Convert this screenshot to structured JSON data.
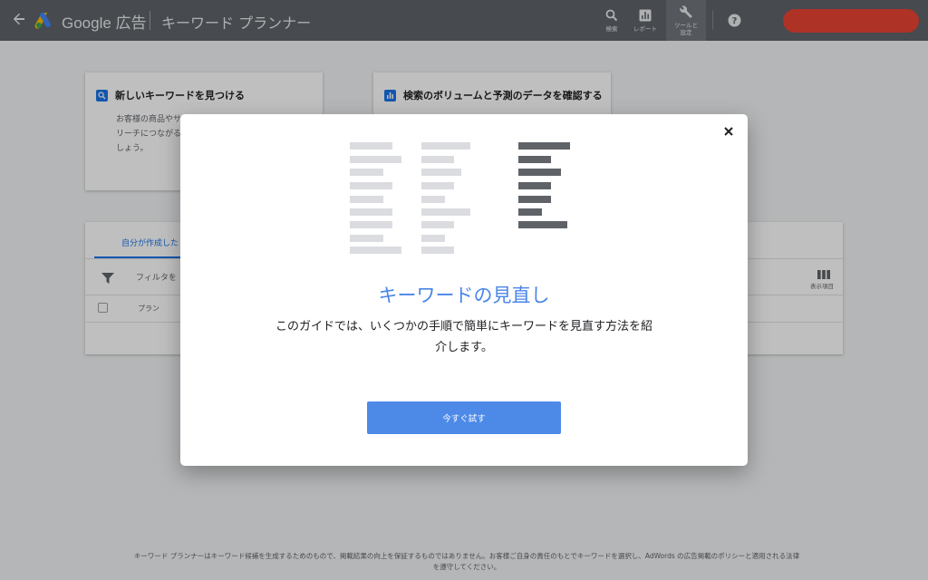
{
  "header": {
    "back_icon": "arrow-left-icon",
    "brand": "Google 広告",
    "product": "キーワード プランナー",
    "search_label": "検索",
    "report_label": "レポート",
    "tools_label_1": "ツールと",
    "tools_label_2": "設定",
    "help_icon": "help-icon"
  },
  "cards": [
    {
      "title": "新しいキーワードを見つける",
      "desc": "お客様の商品やサ… リーチにつながる… しょう。",
      "desc_lines": [
        "お客様の商品やサ",
        "リーチにつながる",
        "しょう。"
      ],
      "icon": "search-icon"
    },
    {
      "title": "検索のボリュームと予測のデータを確認する",
      "icon": "bar-chart-icon"
    }
  ],
  "plans": {
    "tab_label": "自分が作成した",
    "filter_label": "フィルタを",
    "columns_label": "表示項目",
    "plan_column": "プラン"
  },
  "footer": {
    "line1": "キーワード プランナーはキーワード候補を生成するためのもので、掲載結果の向上を保証するものではありません。お客様ご自身の責任のもとでキーワードを選択し、AdWords の広告掲載のポリシーと適用される法律",
    "line2": "を遵守してください。"
  },
  "modal": {
    "title": "キーワードの見直し",
    "body_line1": "このガイドでは、いくつかの手順で簡単にキーワードを見直す方法を紹",
    "body_line2": "介します。",
    "cta_label": "今すぐ試す",
    "close_icon": "close-icon"
  },
  "colors": {
    "header_bg": "#5f6368",
    "accent": "#1a73e8",
    "cta_bg": "#4d8ae8",
    "title_blue": "#4a86e8",
    "account_pill": "#ea4335"
  }
}
